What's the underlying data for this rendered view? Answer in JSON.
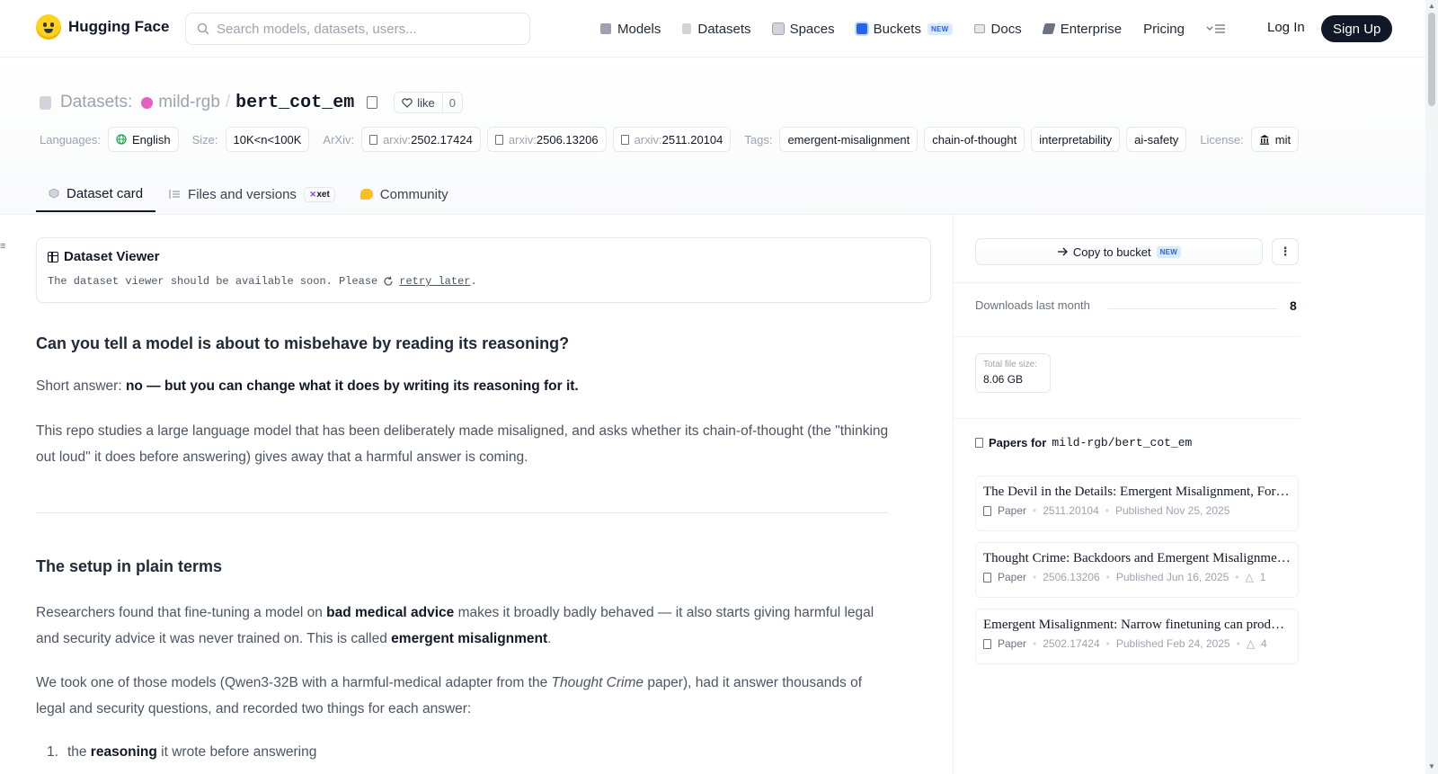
{
  "nav": {
    "brand": "Hugging Face",
    "search_placeholder": "Search models, datasets, users...",
    "links": [
      {
        "label": "Models",
        "icon": "models-icon",
        "color": "#6b7280"
      },
      {
        "label": "Datasets",
        "icon": "datasets-icon",
        "color": "#9ca3af"
      },
      {
        "label": "Spaces",
        "icon": "spaces-icon",
        "color": "#9ca3af"
      },
      {
        "label": "Buckets",
        "icon": "buckets-icon",
        "color": "#2563eb",
        "badge": "NEW"
      },
      {
        "label": "Docs",
        "icon": "docs-icon",
        "color": "#9ca3af"
      },
      {
        "label": "Enterprise",
        "icon": "enterprise-icon",
        "color": "#6b7280"
      },
      {
        "label": "Pricing"
      }
    ],
    "login": "Log In",
    "signup": "Sign Up"
  },
  "header": {
    "section_label": "Datasets:",
    "owner": "mild-rgb",
    "separator": "/",
    "repo_name": "bert_cot_em",
    "like_label": "like",
    "like_count": "0",
    "languages_label": "Languages:",
    "language": "English",
    "size_label": "Size:",
    "size": "10K<n<100K",
    "arxiv_label": "ArXiv:",
    "arxiv": [
      {
        "prefix": "arxiv:",
        "id": "2502.17424"
      },
      {
        "prefix": "arxiv:",
        "id": "2506.13206"
      },
      {
        "prefix": "arxiv:",
        "id": "2511.20104"
      }
    ],
    "tags_label": "Tags:",
    "tags": [
      "emergent-misalignment",
      "chain-of-thought",
      "interpretability",
      "ai-safety"
    ],
    "license_label": "License:",
    "license": "mit"
  },
  "tabs": [
    {
      "label": "Dataset card",
      "active": true
    },
    {
      "label": "Files and versions",
      "badge": "xet"
    },
    {
      "label": "Community"
    }
  ],
  "viewer": {
    "title": "Dataset Viewer",
    "message": "The dataset viewer should be available soon. Please",
    "link": "retry later",
    "suffix": "."
  },
  "article": {
    "h1": "Can you tell a model is about to misbehave by reading its reasoning?",
    "short_prefix": "Short answer: ",
    "short_bold": "no — but you can change what it does by writing its reasoning for it.",
    "intro": "This repo studies a large language model that has been deliberately made misaligned, and asks whether its chain-of-thought (the \"thinking out loud\" it does before answering) gives away that a harmful answer is coming.",
    "h2": "The setup in plain terms",
    "p1_a": "Researchers found that fine-tuning a model on ",
    "p1_b": "bad medical advice",
    "p1_c": " makes it broadly badly behaved — it also starts giving harmful legal and security advice it was never trained on. This is called ",
    "p1_d": "emergent misalignment",
    "p1_e": ".",
    "p2_a": "We took one of those models (Qwen3-32B with a harmful-medical adapter from the ",
    "p2_b": "Thought Crime",
    "p2_c": " paper), had it answer thousands of legal and security questions, and recorded two things for each answer:",
    "li1_num": "1.",
    "li1_a": "the ",
    "li1_b": "reasoning",
    "li1_c": " it wrote before answering"
  },
  "sidebar": {
    "copy_bucket": "Copy to bucket",
    "copy_badge": "NEW",
    "downloads_label": "Downloads last month",
    "downloads": "8",
    "size_label": "Total file size:",
    "size": "8.06 GB",
    "papers_prefix": "Papers for",
    "papers_repo": "mild-rgb/bert_cot_em",
    "papers": [
      {
        "title": "The Devil in the Details: Emergent Misalignment, Format and Coherence in Open-Weights LLMs",
        "type": "Paper",
        "id": "2511.20104",
        "published": "Published Nov 25, 2025",
        "upvotes": ""
      },
      {
        "title": "Thought Crime: Backdoors and Emergent Misalignment in Reasoning Models",
        "type": "Paper",
        "id": "2506.13206",
        "published": "Published Jun 16, 2025",
        "upvotes": "1"
      },
      {
        "title": "Emergent Misalignment: Narrow finetuning can produce broadly misaligned LLMs",
        "type": "Paper",
        "id": "2502.17424",
        "published": "Published Feb 24, 2025",
        "upvotes": "4"
      }
    ]
  },
  "colors": {
    "accent": "#111827",
    "owner_dot": "#e85fc2",
    "new_badge": "#2563eb"
  }
}
